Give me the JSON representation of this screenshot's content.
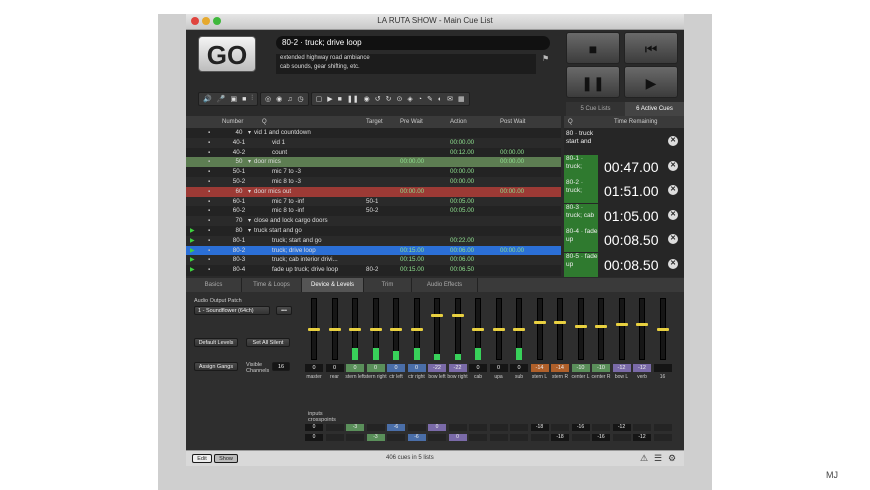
{
  "window_title": "LA RUTA SHOW - Main Cue List",
  "go_label": "GO",
  "current_cue": "80-2 · truck; drive loop",
  "current_notes": [
    "extended highway road ambiance",
    "cab sounds, gear shifting, etc."
  ],
  "side_tabs": [
    "5 Cue Lists",
    "6 Active Cues"
  ],
  "list_headers": {
    "number": "Number",
    "q": "Q",
    "target": "Target",
    "prewait": "Pre Wait",
    "action": "Action",
    "postwait": "Post Wait"
  },
  "rp_headers": {
    "q": "Q",
    "time": "Time Remaining"
  },
  "cues": [
    {
      "number": "40",
      "name": "vid 1 and countdown",
      "target": "",
      "prewait": "",
      "action": "",
      "postwait": "",
      "group": true,
      "style": "normal"
    },
    {
      "number": "40-1",
      "name": "vid 1",
      "target": "",
      "prewait": "",
      "action": "00:00.00",
      "postwait": "",
      "group": false,
      "style": "normal"
    },
    {
      "number": "40-2",
      "name": "count",
      "target": "",
      "prewait": "",
      "action": "00:12.00",
      "postwait": "00:00.00",
      "group": false,
      "style": "normal"
    },
    {
      "number": "50",
      "name": "door mics",
      "target": "",
      "prewait": "00:00.00",
      "action": "",
      "postwait": "00:00.00",
      "group": true,
      "style": "green"
    },
    {
      "number": "50-1",
      "name": "mic 7 to -3",
      "target": "",
      "prewait": "",
      "action": "00:00.00",
      "postwait": "",
      "group": false,
      "style": "normal"
    },
    {
      "number": "50-2",
      "name": "mic 8 to -3",
      "target": "",
      "prewait": "",
      "action": "00:00.00",
      "postwait": "",
      "group": false,
      "style": "normal"
    },
    {
      "number": "60",
      "name": "door mics out",
      "target": "",
      "prewait": "00:00.00",
      "action": "",
      "postwait": "00:00.00",
      "group": true,
      "style": "red"
    },
    {
      "number": "60-1",
      "name": "mic 7 to -inf",
      "target": "50-1",
      "prewait": "",
      "action": "00:05.00",
      "postwait": "",
      "group": false,
      "style": "normal"
    },
    {
      "number": "60-2",
      "name": "mic 8 to -inf",
      "target": "50-2",
      "prewait": "",
      "action": "00:05.00",
      "postwait": "",
      "group": false,
      "style": "normal"
    },
    {
      "number": "70",
      "name": "close and lock cargo doors",
      "target": "",
      "prewait": "",
      "action": "",
      "postwait": "",
      "group": true,
      "style": "normal"
    },
    {
      "number": "80",
      "name": "truck start and go",
      "target": "",
      "prewait": "",
      "action": "",
      "postwait": "",
      "group": true,
      "style": "normal"
    },
    {
      "number": "80-1",
      "name": "truck; start and go",
      "target": "",
      "prewait": "",
      "action": "00:22.00",
      "postwait": "",
      "group": false,
      "style": "normal"
    },
    {
      "number": "80-2",
      "name": "truck; drive loop",
      "target": "",
      "prewait": "00:15.00",
      "action": "00:06.00",
      "postwait": "00:00.00",
      "group": false,
      "style": "selected"
    },
    {
      "number": "80-3",
      "name": "truck; cab interior drivi...",
      "target": "",
      "prewait": "00:15.00",
      "action": "00:06.00",
      "postwait": "",
      "group": false,
      "style": "normal"
    },
    {
      "number": "80-4",
      "name": "fade up truck; drive loop",
      "target": "80-2",
      "prewait": "00:15.00",
      "action": "00:06.50",
      "postwait": "",
      "group": false,
      "style": "normal"
    }
  ],
  "active_cues": [
    {
      "name": "80 · truck start and",
      "time": ""
    },
    {
      "name": "80-1 · truck;",
      "time": "00:47.00"
    },
    {
      "name": "80-2 · truck;",
      "time": "01:51.00"
    },
    {
      "name": "80-3 · truck; cab",
      "time": "01:05.00"
    },
    {
      "name": "80-4 · fade up",
      "time": "00:08.50"
    },
    {
      "name": "80-5 · fade up",
      "time": "00:08.50"
    }
  ],
  "inspector_tabs": [
    "Basics",
    "Time & Loops",
    "Device & Levels",
    "Trim",
    "Audio Effects"
  ],
  "audio_patch_label": "Audio Output Patch",
  "audio_patch_value": "1 - Soundflower (64ch)",
  "edit_label": "•••",
  "buttons": {
    "default_levels": "Default Levels",
    "set_all_silent": "Set All Silent",
    "assign_gangs": "Assign Gangs"
  },
  "visible_channels_label": "Visible Channels",
  "visible_channels": "16",
  "faders": [
    {
      "label": "master",
      "value": "0",
      "level": 0.5,
      "fill": 0,
      "color": ""
    },
    {
      "label": "rear",
      "value": "0",
      "level": 0.5,
      "fill": 0,
      "color": ""
    },
    {
      "label": "stern left",
      "value": "0",
      "level": 0.5,
      "fill": 0.2,
      "color": "#5a8f5a"
    },
    {
      "label": "stern right",
      "value": "0",
      "level": 0.5,
      "fill": 0.2,
      "color": "#5a8f5a"
    },
    {
      "label": "ctr left",
      "value": "0",
      "level": 0.5,
      "fill": 0.15,
      "color": "#4a6ea8"
    },
    {
      "label": "ctr right",
      "value": "0",
      "level": 0.5,
      "fill": 0.2,
      "color": "#4a6ea8"
    },
    {
      "label": "bow left",
      "value": "-22",
      "level": 0.72,
      "fill": 0.1,
      "color": "#7a6aa8"
    },
    {
      "label": "bow right",
      "value": "-22",
      "level": 0.72,
      "fill": 0.1,
      "color": "#7a6aa8"
    },
    {
      "label": "cab",
      "value": "0",
      "level": 0.5,
      "fill": 0.2,
      "color": ""
    },
    {
      "label": "upa",
      "value": "0",
      "level": 0.5,
      "fill": 0,
      "color": ""
    },
    {
      "label": "sub",
      "value": "0",
      "level": 0.5,
      "fill": 0.2,
      "color": ""
    },
    {
      "label": "stern L",
      "value": "-14",
      "level": 0.62,
      "fill": 0,
      "color": "#b0602a"
    },
    {
      "label": "stern R",
      "value": "-14",
      "level": 0.62,
      "fill": 0,
      "color": "#b0602a"
    },
    {
      "label": "center L",
      "value": "-10",
      "level": 0.55,
      "fill": 0,
      "color": "#5a8f5a"
    },
    {
      "label": "center R",
      "value": "-10",
      "level": 0.55,
      "fill": 0,
      "color": "#5a8f5a"
    },
    {
      "label": "bow L",
      "value": "-12",
      "level": 0.58,
      "fill": 0,
      "color": "#7a6aa8"
    },
    {
      "label": "verb",
      "value": "-12",
      "level": 0.58,
      "fill": 0,
      "color": "#7a6aa8"
    },
    {
      "label": "16",
      "value": "",
      "level": 0.5,
      "fill": 0,
      "color": ""
    }
  ],
  "crosspoints_label": "inputs crosspoints",
  "crosspoints": [
    {
      "input": "1",
      "row_value": "0",
      "cells": [
        "",
        "",
        "-3",
        "",
        "-6",
        "",
        "0",
        "",
        "",
        "",
        "",
        "-18",
        "",
        "-16",
        "",
        "-12",
        "",
        ""
      ]
    },
    {
      "input": "2",
      "row_value": "0",
      "cells": [
        "",
        "",
        "",
        "-3",
        "",
        "-6",
        "",
        "0",
        "",
        "",
        "",
        "",
        "-18",
        "",
        "-16",
        "",
        "-12",
        ""
      ]
    }
  ],
  "status": {
    "edit": "Edit",
    "show": "Show",
    "summary": "406 cues in 5 lists"
  },
  "watermark": "MJ"
}
